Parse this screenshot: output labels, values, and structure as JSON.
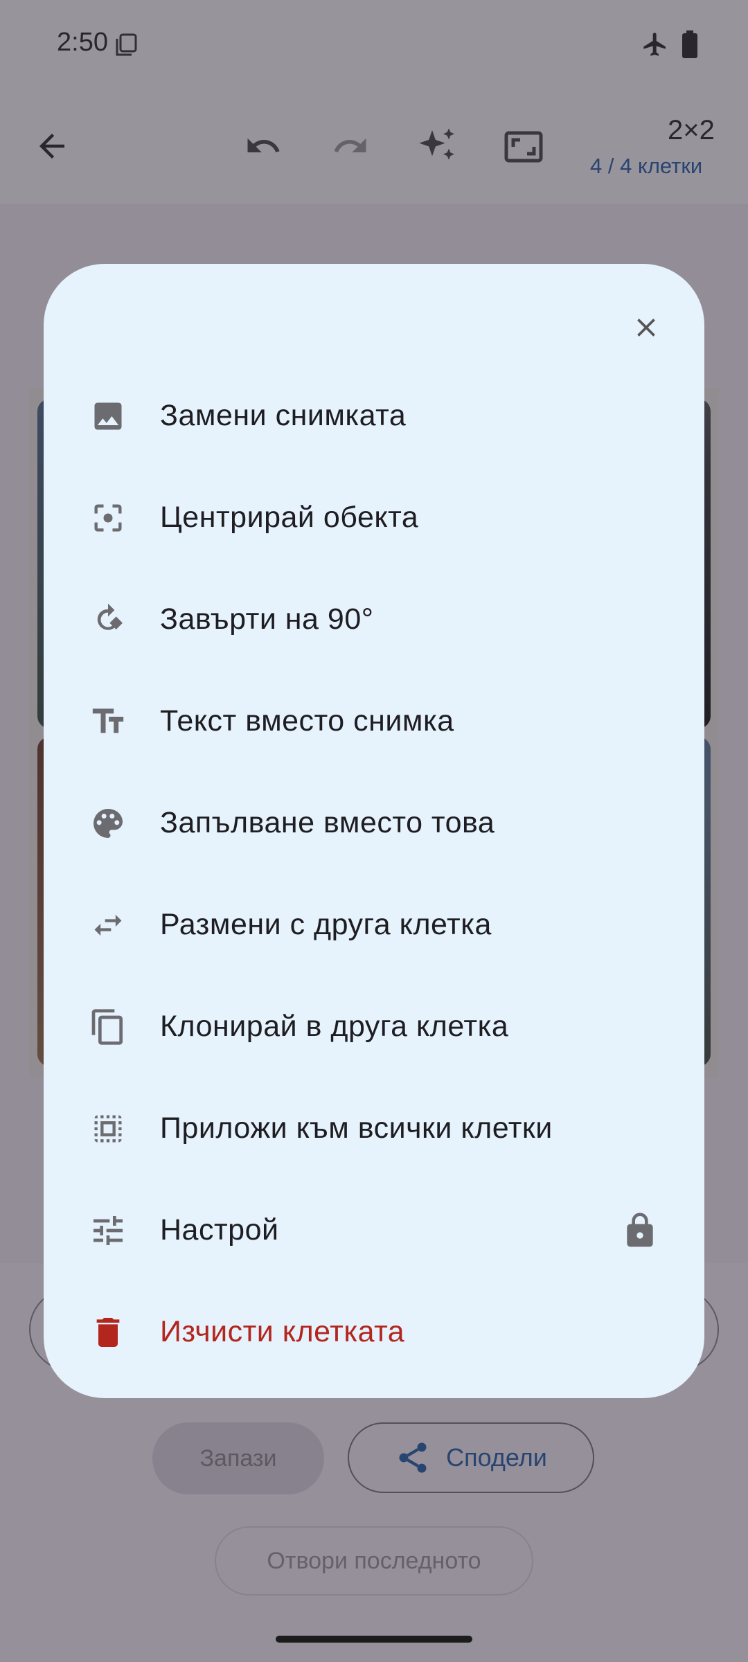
{
  "status_bar": {
    "time": "2:50"
  },
  "toolbar": {
    "grid_size": "2×2",
    "cells_count": "4 / 4 клетки"
  },
  "bottom": {
    "save_label": "Запази",
    "share_label": "Сподели",
    "open_last_label": "Отвори последното"
  },
  "menu": {
    "items": [
      {
        "label": "Замени снимката",
        "icon": "image-icon"
      },
      {
        "label": "Центрирай обекта",
        "icon": "center-focus-icon"
      },
      {
        "label": "Завърти на 90°",
        "icon": "rotate-icon"
      },
      {
        "label": "Текст вместо снимка",
        "icon": "text-icon"
      },
      {
        "label": "Запълване вместо това",
        "icon": "palette-icon"
      },
      {
        "label": "Размени с друга клетка",
        "icon": "swap-icon"
      },
      {
        "label": "Клонирай в друга клетка",
        "icon": "copy-icon"
      },
      {
        "label": "Приложи към всички клетки",
        "icon": "select-all-icon"
      },
      {
        "label": "Настрой",
        "icon": "tune-icon",
        "locked": true
      },
      {
        "label": "Изчисти клетката",
        "icon": "delete-icon",
        "danger": true
      }
    ]
  },
  "colors": {
    "dialog_bg": "#e6f2fc",
    "danger": "#b3261e",
    "accent": "#1f5fa8",
    "icon": "#6b6b70"
  }
}
